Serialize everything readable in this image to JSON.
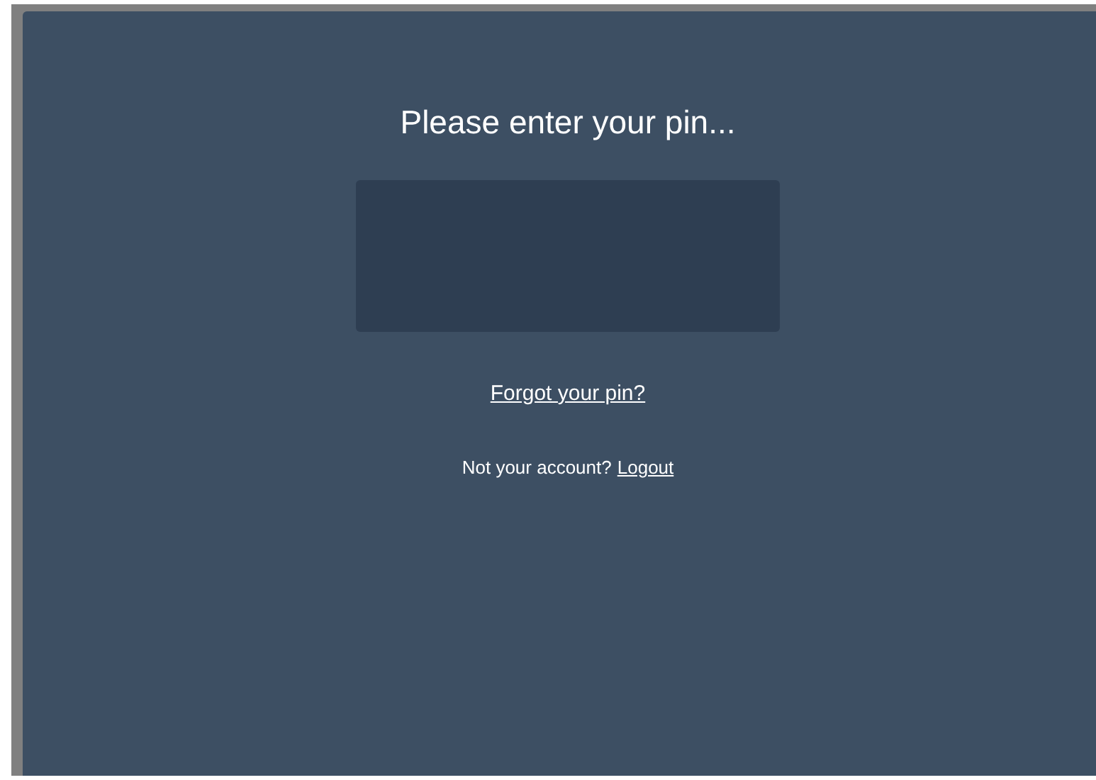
{
  "title": "Please enter your pin...",
  "forgot_link": "Forgot your pin?",
  "account_prompt": "Not your account?",
  "logout_link": "Logout"
}
